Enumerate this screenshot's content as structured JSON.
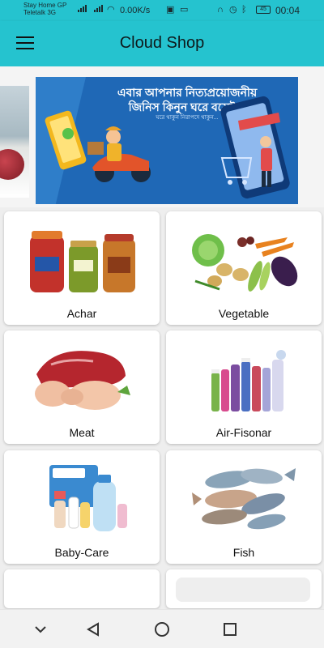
{
  "status_bar": {
    "carrier_1": "Stay Home  GP",
    "carrier_2": "Teletalk 3G",
    "speed": "0.00K/s",
    "battery": "45",
    "time": "00:04"
  },
  "app_bar": {
    "title": "Cloud Shop"
  },
  "banner": {
    "line_1": "এবার আপনার নিত্যপ্রয়োজনীয়",
    "line_2": "জিনিস কিনুন ঘরে বসেই..!",
    "line_3": "ঘরে থাকুন নিরাপদে থাকুন..."
  },
  "categories": [
    {
      "label": "Achar"
    },
    {
      "label": "Vegetable"
    },
    {
      "label": "Meat"
    },
    {
      "label": "Air-Fisonar"
    },
    {
      "label": "Baby-Care"
    },
    {
      "label": "Fish"
    }
  ],
  "colors": {
    "app_bar": "#25c3cf",
    "banner_blue": "#1f68b6",
    "background": "#eeeeee",
    "card": "#ffffff"
  },
  "icons": {
    "menu": "hamburger-menu-icon",
    "nav_back": "triangle-back-icon",
    "nav_home": "circle-home-icon",
    "nav_recents": "square-recents-icon",
    "nav_down": "chevron-down-icon"
  }
}
